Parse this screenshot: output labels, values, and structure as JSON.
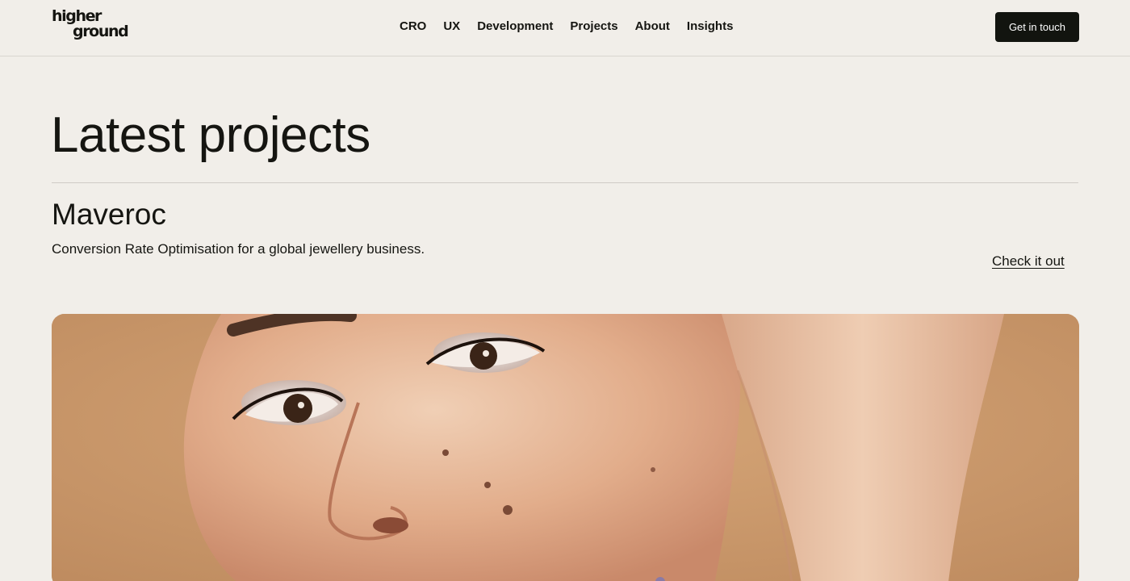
{
  "header": {
    "logo_line1": "higher",
    "logo_line2": "ground",
    "nav": [
      "CRO",
      "UX",
      "Development",
      "Projects",
      "About",
      "Insights"
    ],
    "cta_label": "Get in touch"
  },
  "main": {
    "title": "Latest projects",
    "project": {
      "name": "Maveroc",
      "description": "Conversion Rate Optimisation for a global jewellery business.",
      "link_label": "Check it out"
    }
  },
  "colors": {
    "background": "#f1eee9",
    "text": "#151511",
    "cta_background": "#12140f",
    "cta_text": "#ffffff",
    "photo_background": "#c8976a"
  }
}
